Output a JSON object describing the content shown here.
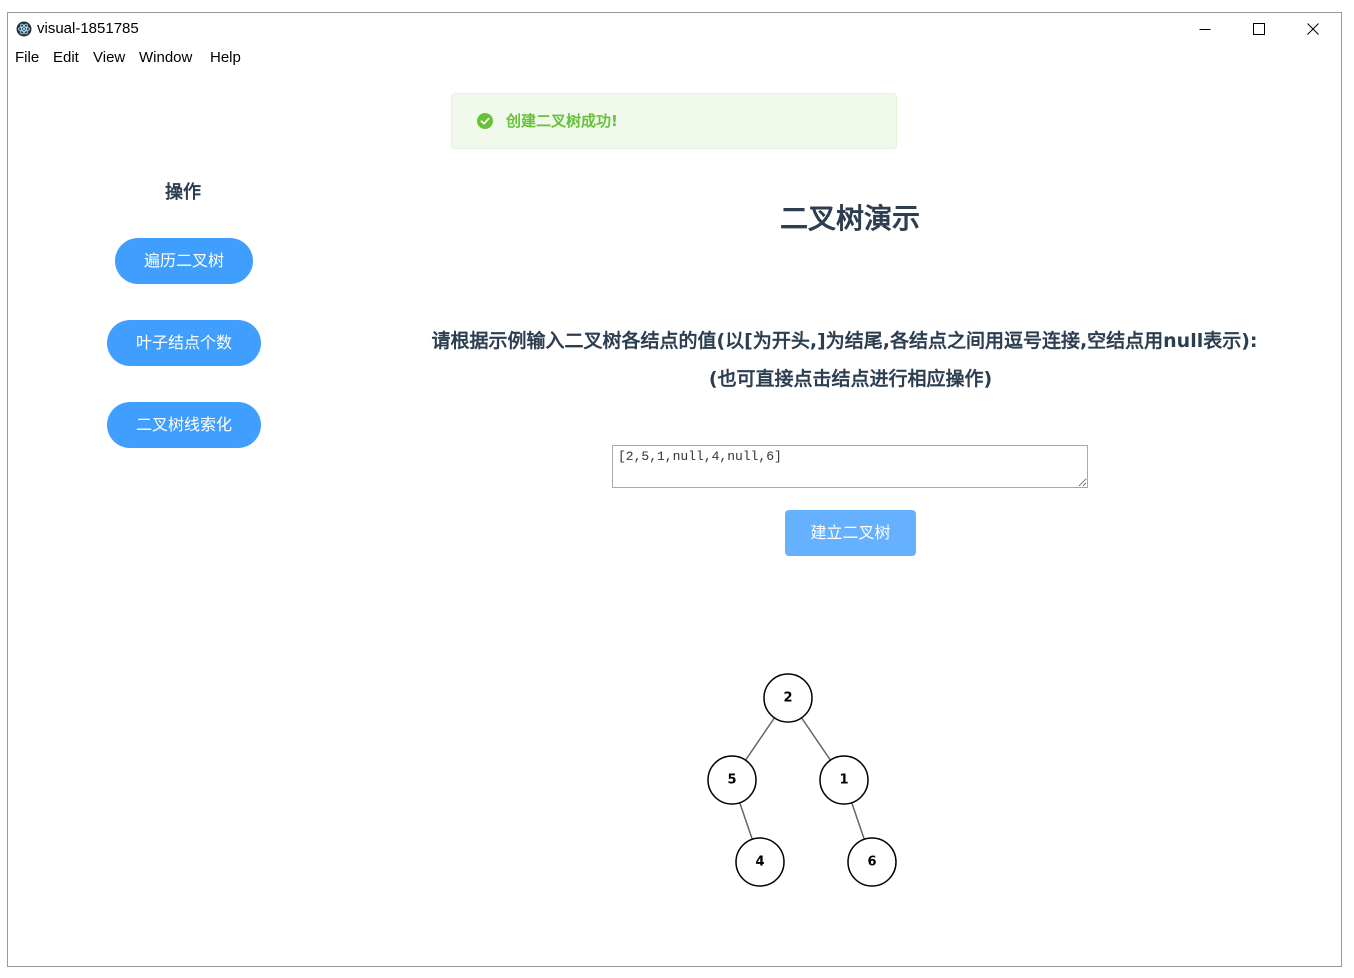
{
  "window": {
    "title": "visual-1851785",
    "app_icon": "electron-atom-icon",
    "controls": [
      "minimize-icon",
      "maximize-icon",
      "close-icon"
    ]
  },
  "menu": [
    {
      "label": "File"
    },
    {
      "label": "Edit"
    },
    {
      "label": "View"
    },
    {
      "label": "Window"
    },
    {
      "label": "Help"
    }
  ],
  "alert": {
    "type": "success",
    "icon": "check-circle-icon",
    "message": "创建二叉树成功!"
  },
  "sidebar": {
    "title": "操作",
    "buttons": [
      {
        "label": "遍历二叉树"
      },
      {
        "label": "叶子结点个数"
      },
      {
        "label": "二叉树线索化"
      }
    ]
  },
  "main": {
    "title": "二叉树演示",
    "instruction": "请根据示例输入二叉树各结点的值(以[为开头,]为结尾,各结点之间用逗号连接,空结点用null表示):",
    "hint": "(也可直接点击结点进行相应操作)",
    "tree_input": {
      "value": "[2,5,1,null,4,null,6]"
    },
    "build_button": "建立二叉树"
  },
  "tree": {
    "nodes": [
      {
        "label": "2"
      },
      {
        "label": "5"
      },
      {
        "label": "1"
      },
      {
        "label": "4"
      },
      {
        "label": "6"
      }
    ],
    "edges": [
      [
        0,
        1
      ],
      [
        0,
        2
      ],
      [
        1,
        3
      ],
      [
        2,
        4
      ]
    ]
  },
  "colors": {
    "primary": "#409eff",
    "primary_light": "#66b1ff",
    "success": "#67c23a",
    "success_bg": "#f0f9eb",
    "success_border": "#e1f3d8",
    "text": "#2c3e50"
  }
}
